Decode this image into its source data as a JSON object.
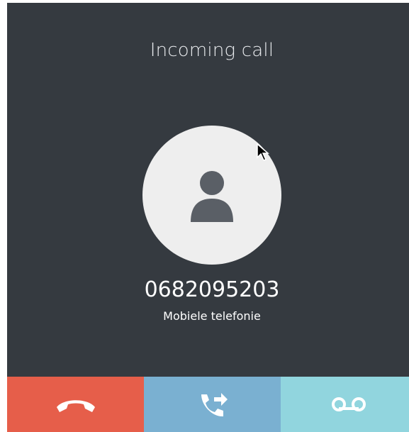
{
  "call": {
    "title": "Incoming call",
    "number": "0682095203",
    "number_label": "Mobiele telefonie"
  },
  "avatar": {
    "icon": "user-icon"
  },
  "actions": [
    {
      "name": "hangup",
      "icon": "phone-hangup-icon",
      "color": "#e65e4a"
    },
    {
      "name": "transfer",
      "icon": "phone-forward-icon",
      "color": "#7ab0d1"
    },
    {
      "name": "voicemail",
      "icon": "voicemail-icon",
      "color": "#91d5de"
    }
  ],
  "colors": {
    "background": "#353a40",
    "avatar_bg": "#eeeeee",
    "avatar_icon": "#5a5f66"
  }
}
